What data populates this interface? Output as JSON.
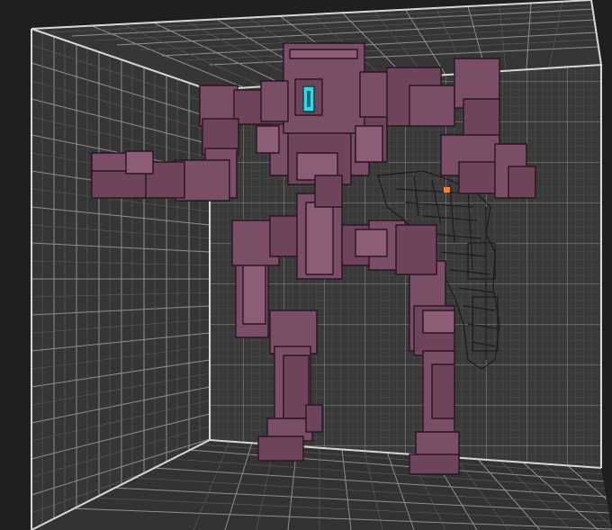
{
  "viewport": {
    "background_color": "#1f1f1f",
    "grid_color": "#8f8f8f",
    "grid_minor_color": "#5e5e5e",
    "edge_color": "#d8d8d8",
    "wall_fill": "#3a3a3a",
    "floor_fill": "#333333",
    "ceiling_fill": "#363636"
  },
  "model": {
    "subject": "voxel-mech-robot",
    "body_color": "#7a4e66",
    "body_shade_color": "#5e3a4f",
    "body_highlight_color": "#8d5d78",
    "outline_color": "#2a1620",
    "visor_color": "#35d8e6",
    "eye_color": "#ff7a2a"
  }
}
